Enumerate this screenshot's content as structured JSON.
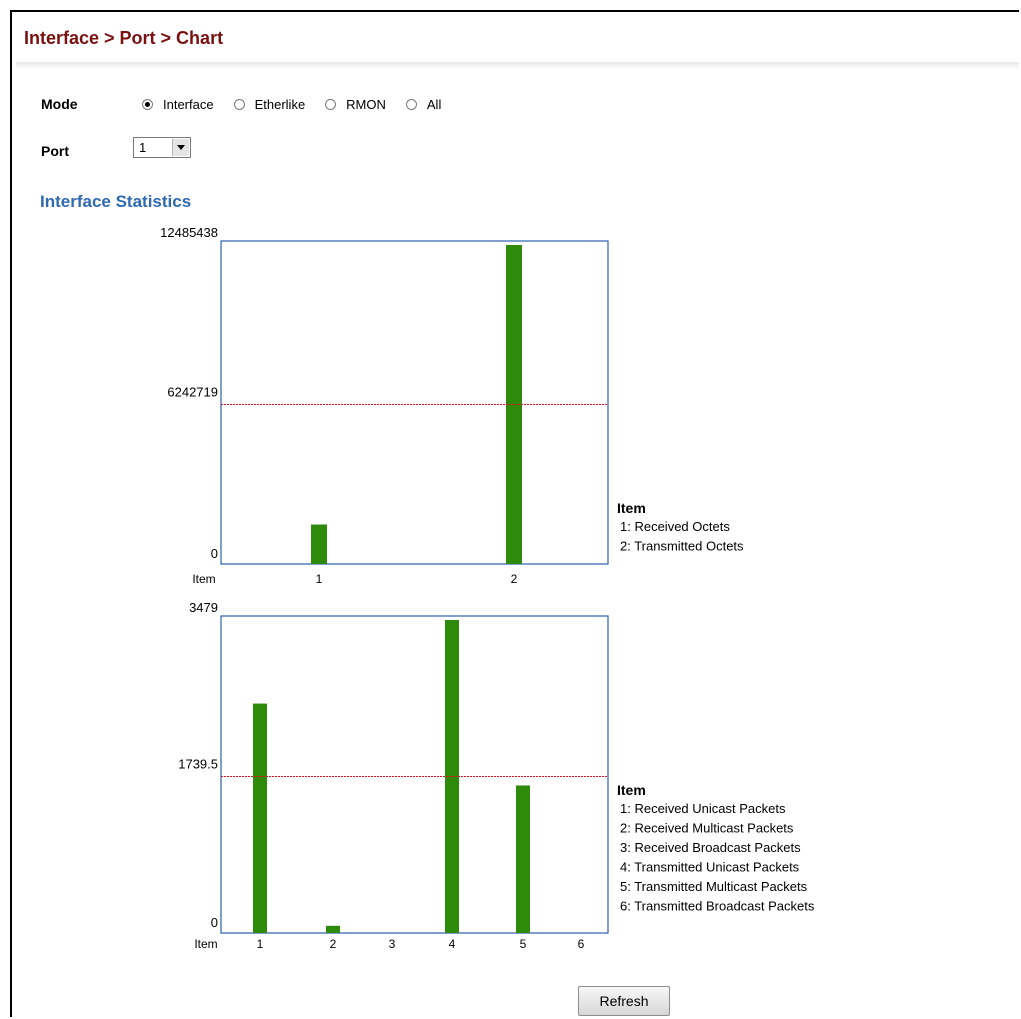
{
  "page": {
    "title": "Interface > Port > Chart"
  },
  "mode": {
    "label": "Mode",
    "options": [
      "Interface",
      "Etherlike",
      "RMON",
      "All"
    ],
    "selected": "Interface"
  },
  "port": {
    "label": "Port",
    "value": "1"
  },
  "section_title": "Interface Statistics",
  "refresh_label": "Refresh",
  "colors": {
    "bar": "#2d8a0b",
    "axis": "#2d5fae",
    "midline": "#e0141e",
    "title": "#7a1010",
    "section": "#2f6ab3"
  },
  "chart_data": [
    {
      "type": "bar",
      "x_title": "Item",
      "categories": [
        "1",
        "2"
      ],
      "values": [
        1545000,
        12485438
      ],
      "yticks": [
        "0",
        "6242719",
        "12485438"
      ],
      "ylim": [
        0,
        12485438
      ],
      "midline": 6242719,
      "legend": {
        "title": "Item",
        "entries": [
          "1: Received Octets",
          "2: Transmitted Octets"
        ],
        "position": "right"
      }
    },
    {
      "type": "bar",
      "x_title": "Item",
      "categories": [
        "1",
        "2",
        "3",
        "4",
        "5",
        "6"
      ],
      "values": [
        2550,
        80,
        0,
        3479,
        1640,
        0
      ],
      "yticks": [
        "0",
        "1739.5",
        "3479"
      ],
      "ylim": [
        0,
        3479
      ],
      "midline": 1739.5,
      "legend": {
        "title": "Item",
        "entries": [
          "1: Received Unicast Packets",
          "2: Received Multicast Packets",
          "3: Received Broadcast Packets",
          "4: Transmitted Unicast Packets",
          "5: Transmitted Multicast Packets",
          "6: Transmitted Broadcast Packets"
        ],
        "position": "right"
      }
    }
  ]
}
